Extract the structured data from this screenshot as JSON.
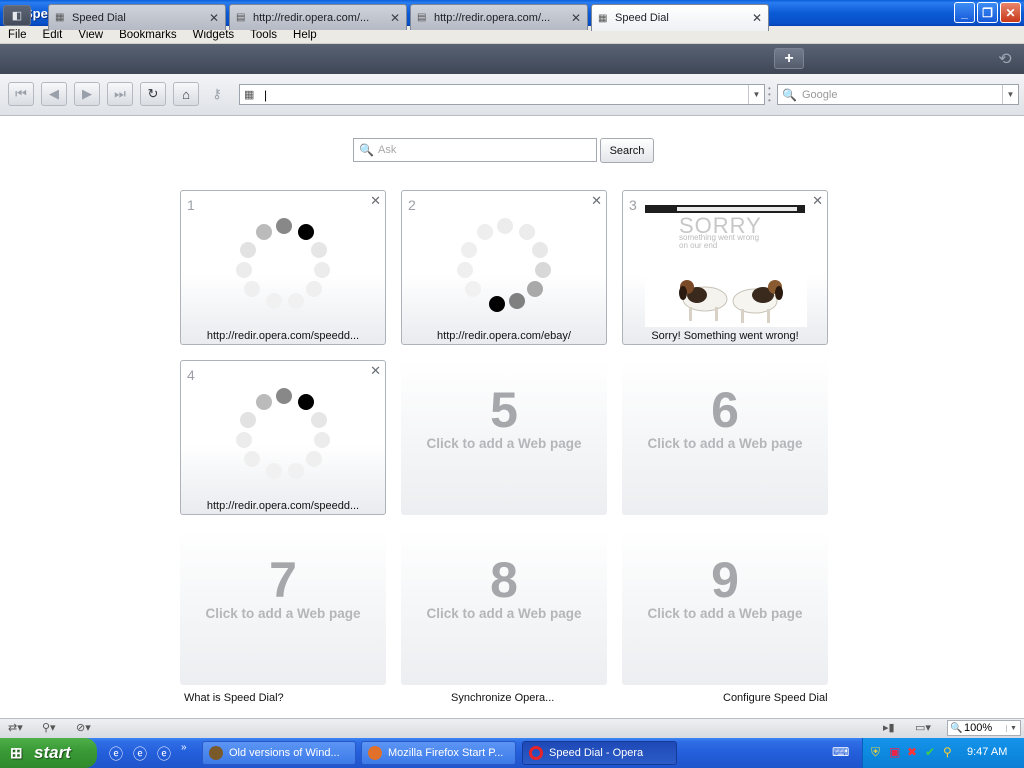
{
  "window": {
    "title": "Speed Dial - Opera"
  },
  "menu": [
    "File",
    "Edit",
    "View",
    "Bookmarks",
    "Widgets",
    "Tools",
    "Help"
  ],
  "tabs": [
    {
      "label": "Speed Dial",
      "icon": "grid-icon"
    },
    {
      "label": "http://redir.opera.com/...",
      "icon": "page-icon"
    },
    {
      "label": "http://redir.opera.com/...",
      "icon": "page-icon"
    },
    {
      "label": "Speed Dial",
      "icon": "grid-icon",
      "active": true
    }
  ],
  "address": {
    "value": "|"
  },
  "search": {
    "placeholder": "Google"
  },
  "ask": {
    "placeholder": "Ask",
    "button": "Search"
  },
  "dials": [
    {
      "number": "1",
      "caption": "http://redir.opera.com/speedd...",
      "state": "loading"
    },
    {
      "number": "2",
      "caption": "http://redir.opera.com/ebay/",
      "state": "loading"
    },
    {
      "number": "3",
      "caption": "Sorry! Something went wrong!",
      "state": "thumbnail",
      "thumb": {
        "heading": "SORRY",
        "subheading": "something went wrong on our end"
      }
    },
    {
      "number": "4",
      "caption": "http://redir.opera.com/speedd...",
      "state": "loading"
    },
    {
      "number": "5",
      "add_text": "Click to add a Web page",
      "state": "empty"
    },
    {
      "number": "6",
      "add_text": "Click to add a Web page",
      "state": "empty"
    },
    {
      "number": "7",
      "add_text": "Click to add a Web page",
      "state": "empty"
    },
    {
      "number": "8",
      "add_text": "Click to add a Web page",
      "state": "empty"
    },
    {
      "number": "9",
      "add_text": "Click to add a Web page",
      "state": "empty"
    }
  ],
  "footer": {
    "what": "What is Speed Dial?",
    "sync": "Synchronize Opera...",
    "configure": "Configure Speed Dial"
  },
  "status": {
    "zoom": "100%"
  },
  "taskbar": {
    "start": "start",
    "windows": [
      {
        "label": "Old versions of Wind...",
        "active": false
      },
      {
        "label": "Mozilla Firefox Start P...",
        "active": false
      },
      {
        "label": "Speed Dial - Opera",
        "active": true
      }
    ],
    "clock": "9:47 AM"
  }
}
